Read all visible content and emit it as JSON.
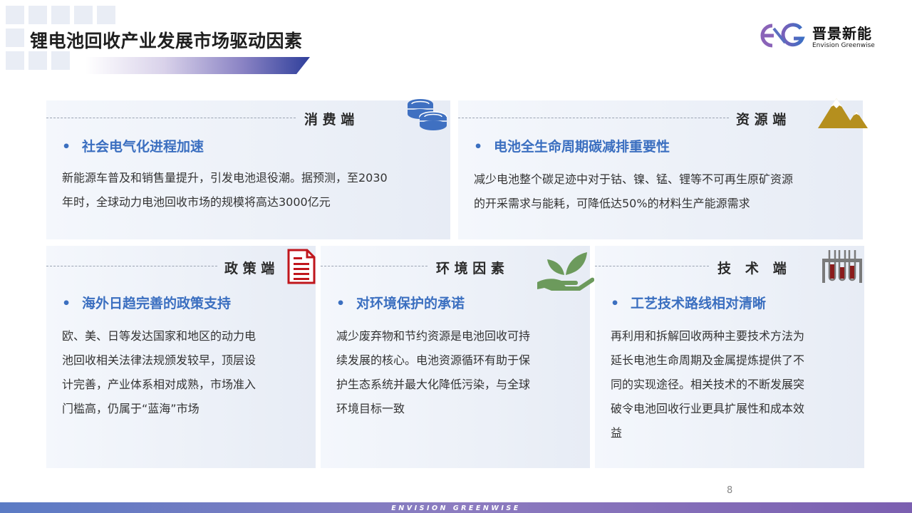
{
  "title": "锂电池回收产业发展市场驱动因素",
  "logo": {
    "cn": "晋景新能",
    "en": "Envision Greenwise"
  },
  "cards": {
    "consumer": {
      "title": "消 费 端",
      "bullet": "社会电气化进程加速",
      "lines": [
        "新能源车普及和销售量提升，引发电池退役潮。据预测，至2030",
        "年时，全球动力电池回收市场的规模将高达3000亿元"
      ],
      "icon": "coins-icon"
    },
    "resource": {
      "title": "资 源 端",
      "bullet": "电池全生命周期碳减排重要性",
      "lines": [
        "减少电池整个碳足迹中对于钴、镍、锰、锂等不可再生原矿资源",
        "的开采需求与能耗，可降低达50%的材料生产能源需求"
      ],
      "icon": "mountain-icon"
    },
    "policy": {
      "title": "政 策 端",
      "bullet": "海外日趋完善的政策支持",
      "lines": [
        "欧、美、日等发达国家和地区的动力电",
        "池回收相关法律法规颁发较早，顶层设",
        "计完善，产业体系相对成熟，市场准入",
        "门槛高，仍属于“蓝海”市场"
      ],
      "icon": "document-icon"
    },
    "environment": {
      "title": "环 境 因 素",
      "bullet": "对环境保护的承诺",
      "lines": [
        "减少废弃物和节约资源是电池回收可持",
        "续发展的核心。电池资源循环有助于保",
        "护生态系统并最大化降低污染，与全球",
        "环境目标一致"
      ],
      "icon": "plant-hand-icon"
    },
    "technology": {
      "title": "技   术   端",
      "bullet": "工艺技术路线相对清晰",
      "lines": [
        "再利用和拆解回收两种主要技术方法为",
        "延长电池生命周期及金属提炼提供了不",
        "同的实现途径。相关技术的不断发展突",
        "破令电池回收行业更具扩展性和成本效",
        "益"
      ],
      "icon": "test-tubes-icon"
    }
  },
  "page_number": "8",
  "footer": "ENVISION GREENWISE",
  "colors": {
    "bullet": "#3b6fc0",
    "coins": "#3f70c1",
    "mountain": "#b58f1e",
    "document": "#c0161c",
    "plant": "#6c9a5c",
    "tubes": "#7a7a7a"
  }
}
